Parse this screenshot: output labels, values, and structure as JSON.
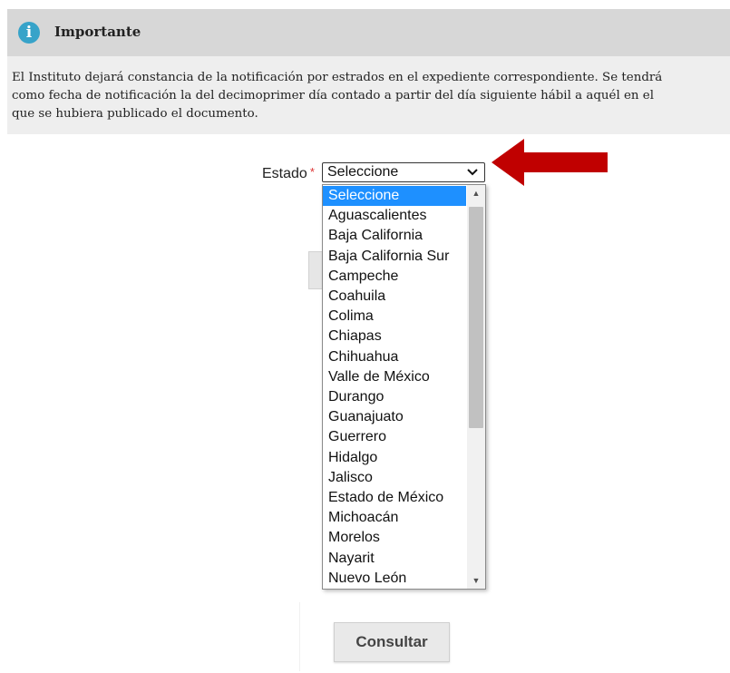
{
  "notice": {
    "title": "Importante",
    "body_line1": "El Instituto dejará constancia de la notificación por estrados en el expediente correspondiente. Se tendrá",
    "body_line2": "como fecha de notificación la del decimoprimer día contado a partir del día siguiente hábil a aquél en el",
    "body_line3": "que se hubiera publicado el documento."
  },
  "form": {
    "estado_label": "Estado",
    "required_mark": "*",
    "selected_value": "Seleccione"
  },
  "dropdown": {
    "options": [
      "Seleccione",
      "Aguascalientes",
      "Baja California",
      "Baja California Sur",
      "Campeche",
      "Coahuila",
      "Colima",
      "Chiapas",
      "Chihuahua",
      "Valle de México",
      "Durango",
      "Guanajuato",
      "Guerrero",
      "Hidalgo",
      "Jalisco",
      "Estado de México",
      "Michoacán",
      "Morelos",
      "Nayarit",
      "Nuevo León"
    ],
    "highlighted_index": 0
  },
  "actions": {
    "consult_label": "Consultar"
  },
  "colors": {
    "info_icon": "#37a3c9",
    "arrow": "#c00000",
    "highlight": "#1e90ff"
  }
}
